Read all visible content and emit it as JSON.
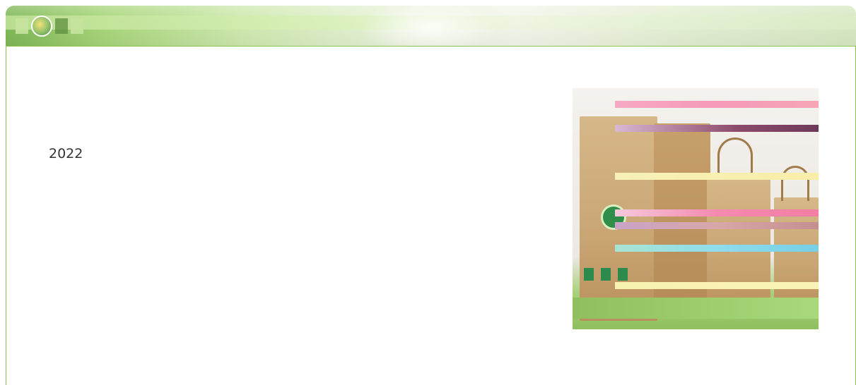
{
  "content": {
    "year": "2022"
  },
  "colors": {
    "frame_border": "#8cc24e",
    "banner_start": "#7fb857",
    "banner_end": "#d7e8c3",
    "text": "#333333"
  },
  "icons": {
    "banner_logo": "company-logo-icon"
  }
}
